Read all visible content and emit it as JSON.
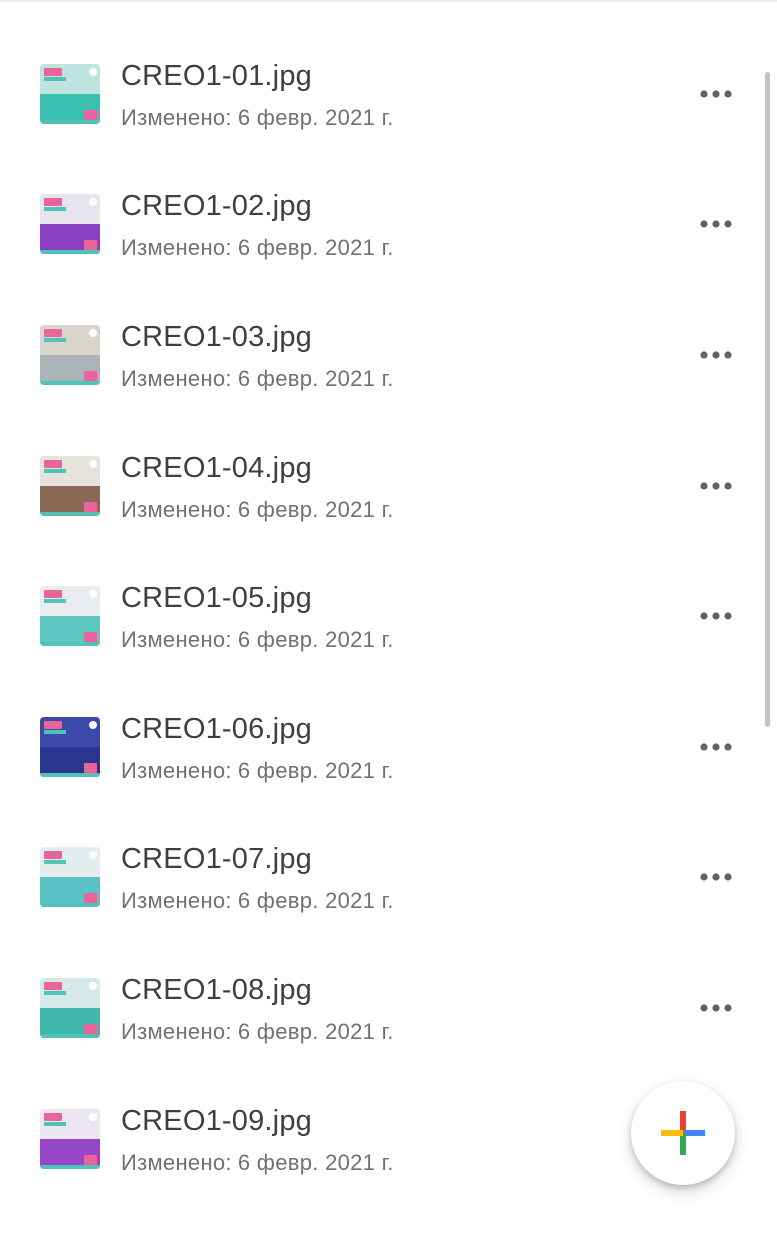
{
  "files": [
    {
      "name": "CREO1-01.jpg",
      "modified_label": "Изменено:",
      "modified_date": "6 февр. 2021 г.",
      "thumb": {
        "bg": "#bfe3de",
        "accent": "#3bbfb0"
      }
    },
    {
      "name": "CREO1-02.jpg",
      "modified_label": "Изменено:",
      "modified_date": "6 февр. 2021 г.",
      "thumb": {
        "bg": "#e8e4ee",
        "accent": "#8a3fc1"
      }
    },
    {
      "name": "CREO1-03.jpg",
      "modified_label": "Изменено:",
      "modified_date": "6 февр. 2021 г.",
      "thumb": {
        "bg": "#d9d4cc",
        "accent": "#a9b3b8"
      }
    },
    {
      "name": "CREO1-04.jpg",
      "modified_label": "Изменено:",
      "modified_date": "6 февр. 2021 г.",
      "thumb": {
        "bg": "#e6e2dc",
        "accent": "#8b6a55"
      }
    },
    {
      "name": "CREO1-05.jpg",
      "modified_label": "Изменено:",
      "modified_date": "6 февр. 2021 г.",
      "thumb": {
        "bg": "#e9ecef",
        "accent": "#5cc6c0"
      }
    },
    {
      "name": "CREO1-06.jpg",
      "modified_label": "Изменено:",
      "modified_date": "6 февр. 2021 г.",
      "thumb": {
        "bg": "#3b4aa8",
        "accent": "#2a3590"
      }
    },
    {
      "name": "CREO1-07.jpg",
      "modified_label": "Изменено:",
      "modified_date": "6 февр. 2021 г.",
      "thumb": {
        "bg": "#e3ecef",
        "accent": "#58c1c6"
      }
    },
    {
      "name": "CREO1-08.jpg",
      "modified_label": "Изменено:",
      "modified_date": "6 февр. 2021 г.",
      "thumb": {
        "bg": "#d5e9e6",
        "accent": "#3fb7ad"
      }
    },
    {
      "name": "CREO1-09.jpg",
      "modified_label": "Изменено:",
      "modified_date": "6 февр. 2021 г.",
      "thumb": {
        "bg": "#ece6f1",
        "accent": "#9747c6"
      }
    }
  ],
  "icons": {
    "more": "more-horizontal-icon",
    "fab": "google-plus-icon"
  },
  "colors": {
    "text_primary": "#3c4043",
    "text_secondary": "#6f7175",
    "dots": "#5f6368",
    "fab_blue": "#4285F4",
    "fab_red": "#EA4335",
    "fab_yellow": "#FBBC05",
    "fab_green": "#34A853",
    "badge_pink": "#e8649a",
    "badge_teal": "#4fc3b8"
  }
}
